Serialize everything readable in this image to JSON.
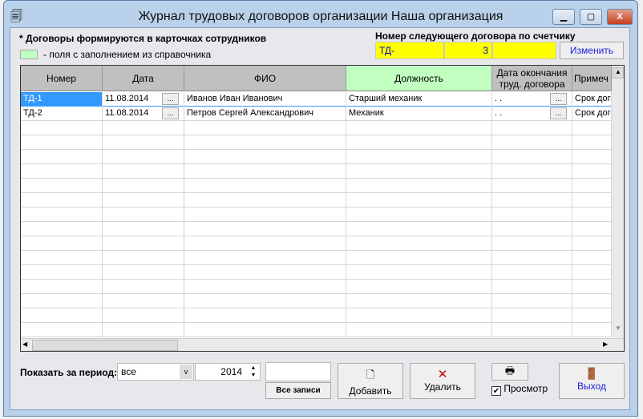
{
  "window": {
    "title": "Журнал трудовых договоров организации  Наша организация",
    "minimize": "▭",
    "maximize": "▢",
    "close": "X"
  },
  "notes": {
    "formed": "* Договоры формируются в карточках сотрудников",
    "legend": "- поля с заполнением из справочника",
    "legend_color": "#c0ffc0"
  },
  "counter": {
    "label": "Номер следующего договора по счетчику",
    "prefix": "ТД-",
    "number": "3",
    "suffix": "",
    "change_button": "Изменить"
  },
  "table": {
    "columns": [
      "Номер",
      "Дата",
      "ФИО",
      "Должность",
      "Дата окончания труд. договора",
      "Примеч"
    ],
    "rows": [
      {
        "number": "ТД-1",
        "date": "11.08.2014",
        "fio": "Иванов Иван Иванович",
        "position": "Старший механик",
        "end_date": " .  .",
        "note": "Срок договора"
      },
      {
        "number": "ТД-2",
        "date": "11.08.2014",
        "fio": "Петров Сергей Александрович",
        "position": "Механик",
        "end_date": " .  .",
        "note": "Срок договора"
      }
    ],
    "dots": "..."
  },
  "footer": {
    "period_label": "Показать за период:",
    "period_value": "все",
    "year": "2014",
    "filter_value": "",
    "all_records": "Все записи",
    "add": "Добавить",
    "delete": "Удалить",
    "preview": "Просмотр",
    "preview_checked": true,
    "exit": "Выход"
  }
}
